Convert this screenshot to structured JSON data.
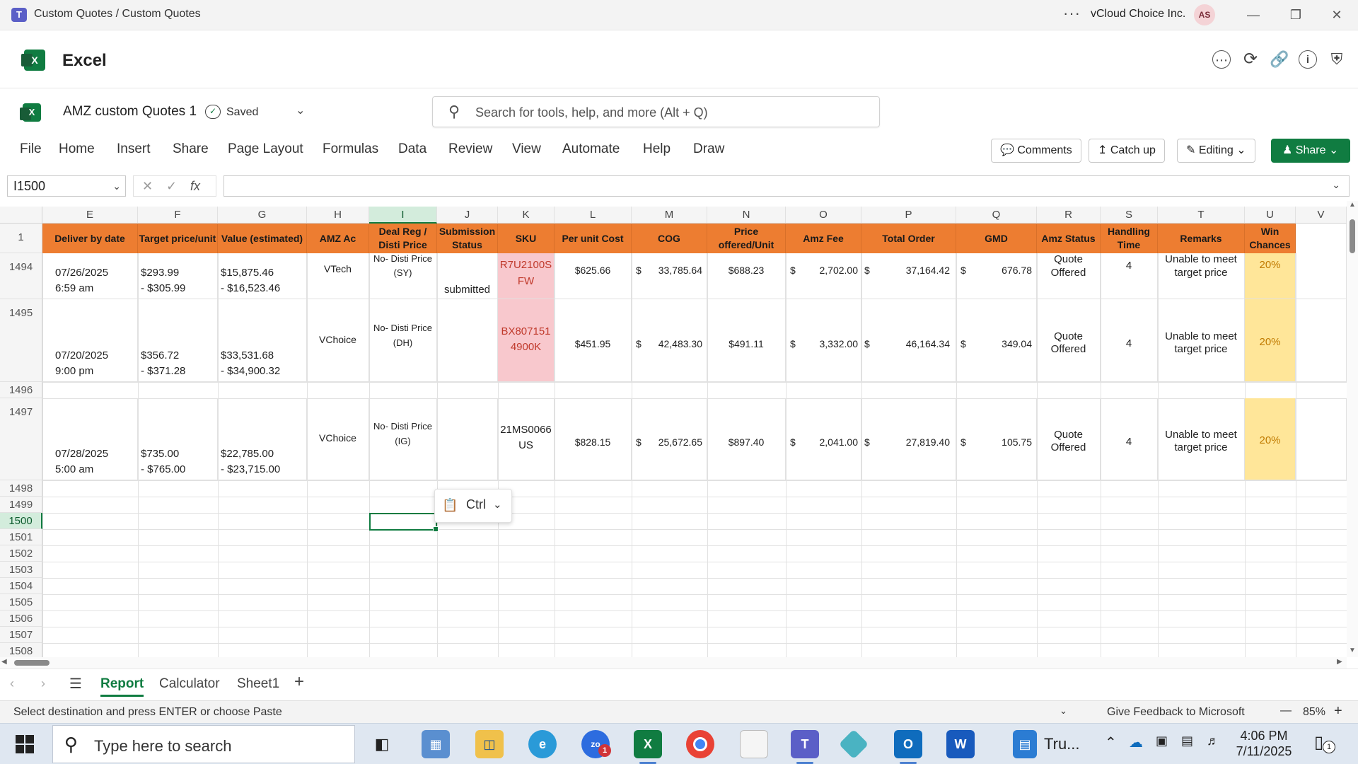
{
  "window": {
    "title": "Custom Quotes / Custom Quotes",
    "more": "···",
    "org": "vCloud Choice Inc.",
    "avatar": "AS"
  },
  "app": {
    "name": "Excel"
  },
  "document": {
    "name": "AMZ custom Quotes 1",
    "status": "Saved"
  },
  "search": {
    "placeholder": "Search for tools, help, and more (Alt + Q)"
  },
  "menu": [
    "File",
    "Home",
    "Insert",
    "Share",
    "Page Layout",
    "Formulas",
    "Data",
    "Review",
    "View",
    "Automate",
    "Help",
    "Draw"
  ],
  "ribbon_buttons": {
    "comments": "Comments",
    "catch_up": "Catch up",
    "editing": "Editing",
    "share": "Share"
  },
  "formula_bar": {
    "name_box": "I1500",
    "fx": "fx",
    "formula": ""
  },
  "columns": [
    "E",
    "F",
    "G",
    "H",
    "I",
    "J",
    "K",
    "L",
    "M",
    "N",
    "O",
    "P",
    "Q",
    "R",
    "S",
    "T",
    "U",
    "V"
  ],
  "selected_column": "I",
  "header_row": {
    "row": "1",
    "cells": [
      "Deliver by date",
      "Target price/unit",
      "Value (estimated)",
      "AMZ Ac",
      "Deal Reg / Disti Price",
      "Submission Status",
      "SKU",
      "Per unit Cost",
      "COG",
      "Price offered/Unit",
      "Amz Fee",
      "Total Order",
      "GMD",
      "Amz Status",
      "Handling Time",
      "Remarks",
      "Win Chances",
      ""
    ]
  },
  "rows": [
    {
      "row": "1494",
      "date": "07/26/2025",
      "time": "6:59 am",
      "target_a": "$293.99",
      "target_b": "- $305.99",
      "value_a": "$15,875.46",
      "value_b": "- $16,523.46",
      "account": "VTech",
      "deal_a": "No- Disti Price",
      "deal_b": "(SY)",
      "submission": "submitted",
      "sku_a": "R7U2100S",
      "sku_b": "FW",
      "unit_cost": "$625.66",
      "cog_sym": "$",
      "cog": "33,785.64",
      "price_offered": "$688.23",
      "fee_sym": "$",
      "fee": "2,702.00",
      "total_sym": "$",
      "total": "37,164.42",
      "gmd_sym": "$",
      "gmd": "676.78",
      "amz_a": "Quote",
      "amz_b": "Offered",
      "handling": "4",
      "remark_a": "Unable to meet",
      "remark_b": "target price",
      "win": "20%"
    },
    {
      "row": "1495",
      "date": "07/20/2025",
      "time": "9:00 pm",
      "target_a": "$356.72",
      "target_b": "- $371.28",
      "value_a": "$33,531.68",
      "value_b": "- $34,900.32",
      "account": "VChoice",
      "deal_a": "No- Disti Price",
      "deal_b": "(DH)",
      "submission": "",
      "sku_a": "BX807151",
      "sku_b": "4900K",
      "unit_cost": "$451.95",
      "cog_sym": "$",
      "cog": "42,483.30",
      "price_offered": "$491.11",
      "fee_sym": "$",
      "fee": "3,332.00",
      "total_sym": "$",
      "total": "46,164.34",
      "gmd_sym": "$",
      "gmd": "349.04",
      "amz_a": "Quote",
      "amz_b": "Offered",
      "handling": "4",
      "remark_a": "Unable to meet",
      "remark_b": "target price",
      "win": "20%"
    },
    {
      "row": "1497",
      "date": "07/28/2025",
      "time": "5:00 am",
      "target_a": "$735.00",
      "target_b": "- $765.00",
      "value_a": "$22,785.00",
      "value_b": "- $23,715.00",
      "account": "VChoice",
      "deal_a": "No- Disti Price",
      "deal_b": "(IG)",
      "submission": "",
      "sku_a": "21MS0066",
      "sku_b": "US",
      "unit_cost": "$828.15",
      "cog_sym": "$",
      "cog": "25,672.65",
      "price_offered": "$897.40",
      "fee_sym": "$",
      "fee": "2,041.00",
      "total_sym": "$",
      "total": "27,819.40",
      "gmd_sym": "$",
      "gmd": "105.75",
      "amz_a": "Quote",
      "amz_b": "Offered",
      "handling": "4",
      "remark_a": "Unable to meet",
      "remark_b": "target price",
      "win": "20%"
    }
  ],
  "empty_rows": [
    "1496",
    "1498",
    "1499",
    "1500",
    "1501",
    "1502",
    "1503",
    "1504",
    "1505",
    "1506",
    "1507",
    "1508"
  ],
  "selected_row": "1500",
  "paste_options": {
    "label": "Ctrl"
  },
  "sheets": {
    "tabs": [
      "Report",
      "Calculator",
      "Sheet1"
    ],
    "active": "Report",
    "add": "+"
  },
  "status_bar": {
    "message": "Select destination and press ENTER or choose Paste",
    "feedback": "Give Feedback to Microsoft",
    "zoom": "85%",
    "minus": "—",
    "plus": "+"
  },
  "taskbar": {
    "search_placeholder": "Type here to search",
    "time": "4:06 PM",
    "date": "7/11/2025",
    "zoom_badge": "1",
    "notif_badge": "1",
    "truncated_app": "Tru..."
  },
  "colors": {
    "excel_green": "#107c41",
    "header_orange": "#ed7d31",
    "sku_pink": "#f8c8cd",
    "win_yellow": "#ffe699"
  }
}
